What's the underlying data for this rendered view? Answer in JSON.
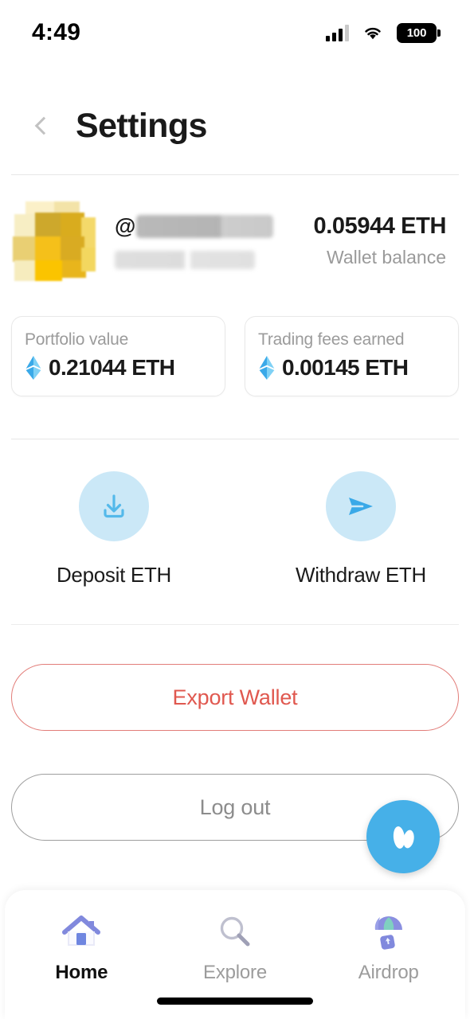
{
  "status_bar": {
    "time": "4:49",
    "signal_icon": "cellular-signal-icon",
    "wifi_icon": "wifi-icon",
    "battery_level": "100"
  },
  "header": {
    "back_icon": "chevron-left-icon",
    "title": "Settings"
  },
  "profile": {
    "avatar_icon": "user-avatar-pixelated",
    "handle_prefix": "@",
    "handle_redacted": true,
    "subtitle_redacted": true,
    "wallet_balance_amount": "0.05944 ETH",
    "wallet_balance_label": "Wallet balance"
  },
  "stats": [
    {
      "label": "Portfolio value",
      "value": "0.21044 ETH",
      "icon": "ethereum-icon"
    },
    {
      "label": "Trading fees earned",
      "value": "0.00145 ETH",
      "icon": "ethereum-icon"
    }
  ],
  "actions": [
    {
      "label": "Deposit ETH",
      "icon": "download-tray-icon"
    },
    {
      "label": "Withdraw ETH",
      "icon": "send-plane-icon"
    }
  ],
  "buttons": {
    "export_wallet": "Export Wallet",
    "log_out": "Log out"
  },
  "fab": {
    "icon": "butterfly-logo-icon"
  },
  "bottom_nav": [
    {
      "label": "Home",
      "icon": "home-icon",
      "active": true
    },
    {
      "label": "Explore",
      "icon": "search-magnifier-icon",
      "active": false
    },
    {
      "label": "Airdrop",
      "icon": "parachute-icon",
      "active": false
    }
  ],
  "colors": {
    "accent_blue": "#46b0e8",
    "action_circle_bg": "#cbe8f7",
    "export_red": "#e0584f",
    "muted_gray": "#9a9a9a",
    "nav_icon_purple": "#8189dd"
  }
}
